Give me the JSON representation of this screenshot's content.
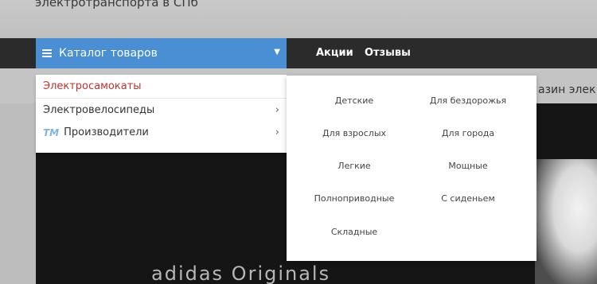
{
  "header": {
    "title": "электротранспорта в СПб"
  },
  "navbar": {
    "catalog_label": "Каталог товаров",
    "links": [
      "Акции",
      "Отзывы"
    ]
  },
  "banner": {
    "side_text": "азин элек",
    "brand_text": "adidas Originals"
  },
  "dropdown": {
    "items": [
      {
        "label": "Электросамокаты",
        "active": true
      },
      {
        "label": "Электровелосипеды",
        "has_submenu": true
      },
      {
        "label": "Производители",
        "icon": "tm-icon",
        "icon_text": "TM",
        "has_submenu": true
      }
    ]
  },
  "submenu": {
    "items": [
      "Детские",
      "Для бездорожья",
      "Для взрослых",
      "Для города",
      "Легкие",
      "Мощные",
      "Полноприводные",
      "С сиденьем",
      "Складные"
    ]
  },
  "colors": {
    "accent": "#4a8fd4",
    "active": "#c0312f",
    "navbar": "#2b2b2b"
  }
}
